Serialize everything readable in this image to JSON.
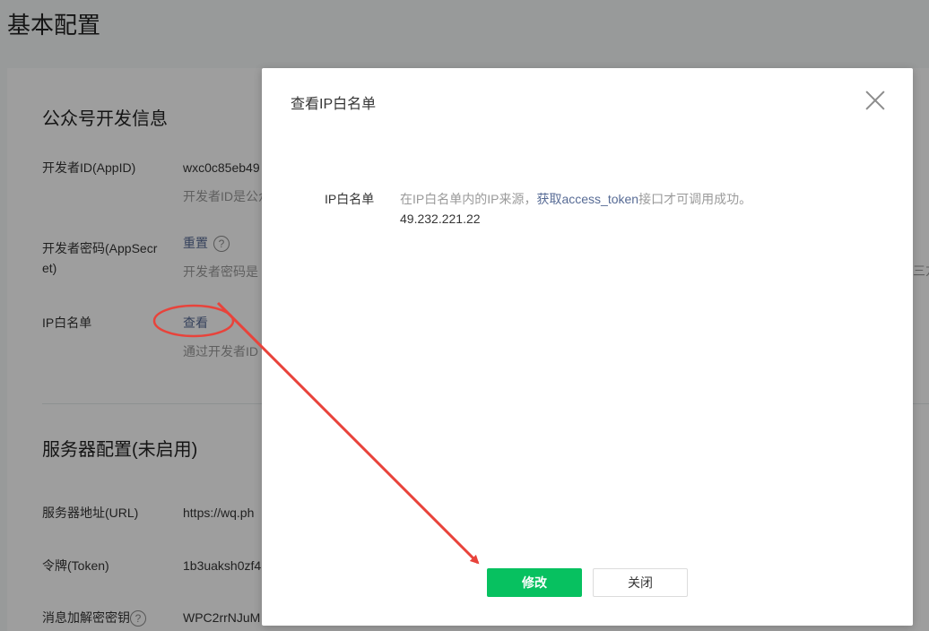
{
  "page": {
    "title": "基本配置",
    "dev_info": {
      "section_title": "公众号开发信息",
      "appid_label": "开发者ID(AppID)",
      "appid_value": "wxc0c85eb49",
      "appid_hint": "开发者ID是公众",
      "secret_label": "开发者密码(AppSecret)",
      "secret_reset": "重置",
      "secret_hint": "开发者密码是",
      "secret_far_text": "三方",
      "ip_label": "IP白名单",
      "ip_view": "查看",
      "ip_hint": "通过开发者ID"
    },
    "server": {
      "section_title": "服务器配置(未启用)",
      "url_label": "服务器地址(URL)",
      "url_value": "https://wq.ph",
      "token_label": "令牌(Token)",
      "token_value": "1b3uaksh0zf4",
      "aes_label": "消息加解密密钥",
      "aes_value": "WPC2rrNJuM"
    }
  },
  "dialog": {
    "title": "查看IP白名单",
    "field_label": "IP白名单",
    "desc_prefix": "在IP白名单内的IP来源，",
    "desc_link": "获取access_token",
    "desc_suffix": "接口才可调用成功。",
    "ip_value": "49.232.221.22",
    "primary_button": "修改",
    "secondary_button": "关闭"
  },
  "colors": {
    "accent": "#07c160",
    "link": "#576b95",
    "annotation": "#e8433b"
  }
}
